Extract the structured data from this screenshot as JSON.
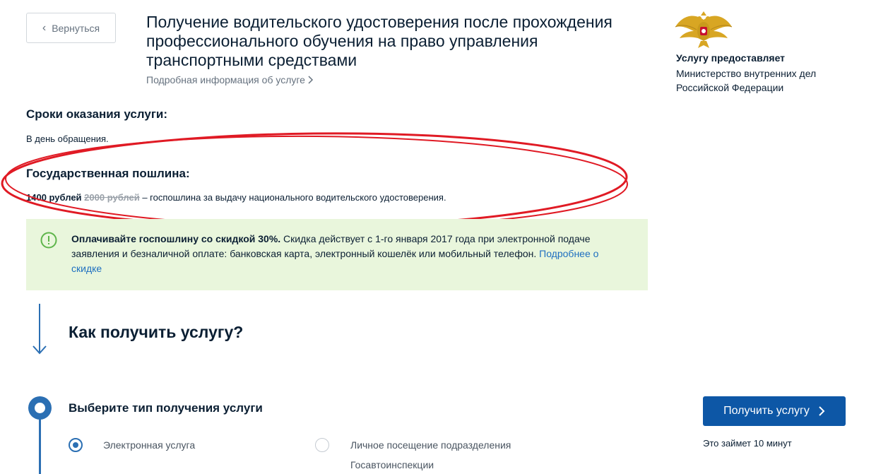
{
  "header": {
    "back_label": "Вернуться",
    "title": "Получение водительского удостоверения после прохождения профессионального обучения на право управления транспортными средствами",
    "info_link": "Подробная информация об услуге"
  },
  "provider": {
    "label": "Услугу предоставляет",
    "name": "Министерство внутренних дел Российской Федерации",
    "emblem_icon": "eagle-emblem-icon"
  },
  "terms": {
    "heading": "Сроки оказания услуги:",
    "text": "В день обращения."
  },
  "fee": {
    "heading": "Государственная пошлина:",
    "price": "1400 рублей",
    "old_price": "2000 рублей",
    "description": " – госпошлина за выдачу национального водительского удостоверения."
  },
  "discount": {
    "bold_text": "Оплачивайте госпошлину со скидкой 30%.",
    "text": " Скидка действует с 1-го января 2017 года при электронной подаче заявления и безналичной оплате: банковская карта, электронный кошелёк или мобильный телефон. ",
    "link": "Подробнее о скидке",
    "icon": "exclamation-circle-icon",
    "bg_color": "#e9f6dc"
  },
  "how": {
    "title": "Как получить услугу?"
  },
  "step": {
    "title": "Выберите тип получения услуги",
    "options": [
      {
        "label": "Электронная услуга",
        "selected": true
      },
      {
        "label": "Личное посещение подразделения Госавтоинспекции",
        "selected": false
      }
    ]
  },
  "cta": {
    "button_label": "Получить услугу",
    "time_note": "Это займет 10 минут",
    "color": "#0d57a6"
  }
}
